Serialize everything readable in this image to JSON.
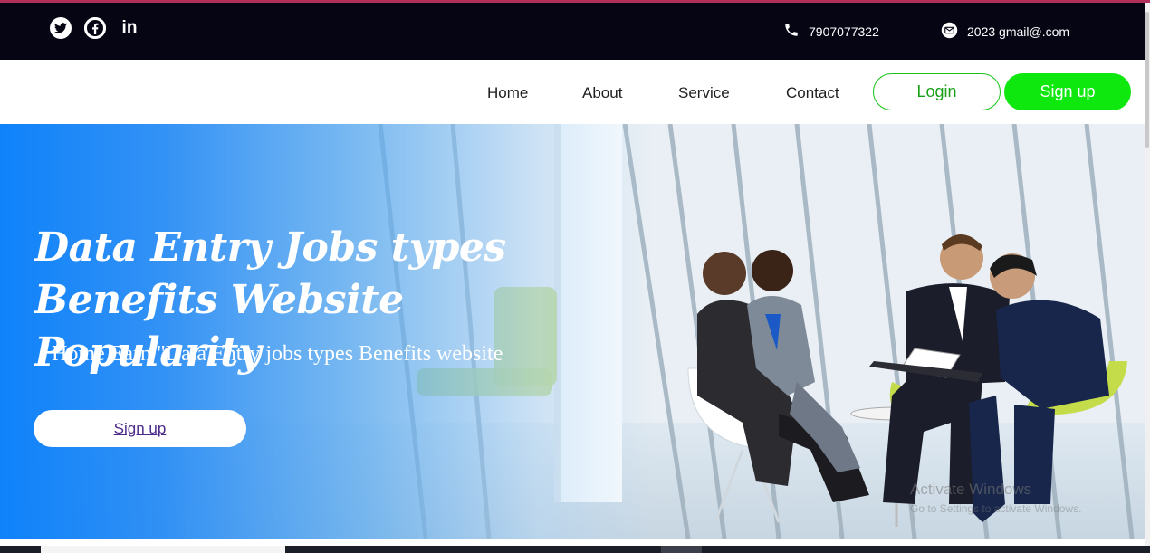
{
  "topbar": {
    "social_icons": [
      "twitter-icon",
      "facebook-icon",
      "linkedin-icon"
    ],
    "linkedin_glyph": "in",
    "phone": "7907077322",
    "email": "2023 gmail@.com"
  },
  "nav": {
    "links": [
      "Home",
      "About",
      "Service",
      "Contact"
    ],
    "login": "Login",
    "signup": "Sign up"
  },
  "hero": {
    "title_line1": "Data Entry Jobs types",
    "title_line2": "Benefits Website Popularity",
    "subtitle": "Home Earn \"Data Entry jobs types Benefits website",
    "cta": "Sign up",
    "watermark": "Activate Windows",
    "watermark_sub": "Go to Settings to activate Windows."
  },
  "colors": {
    "topbar_bg": "#050514",
    "brand_green": "#0ee80e",
    "hero_blue": "#0f82fa",
    "accent": "#b0305c"
  }
}
